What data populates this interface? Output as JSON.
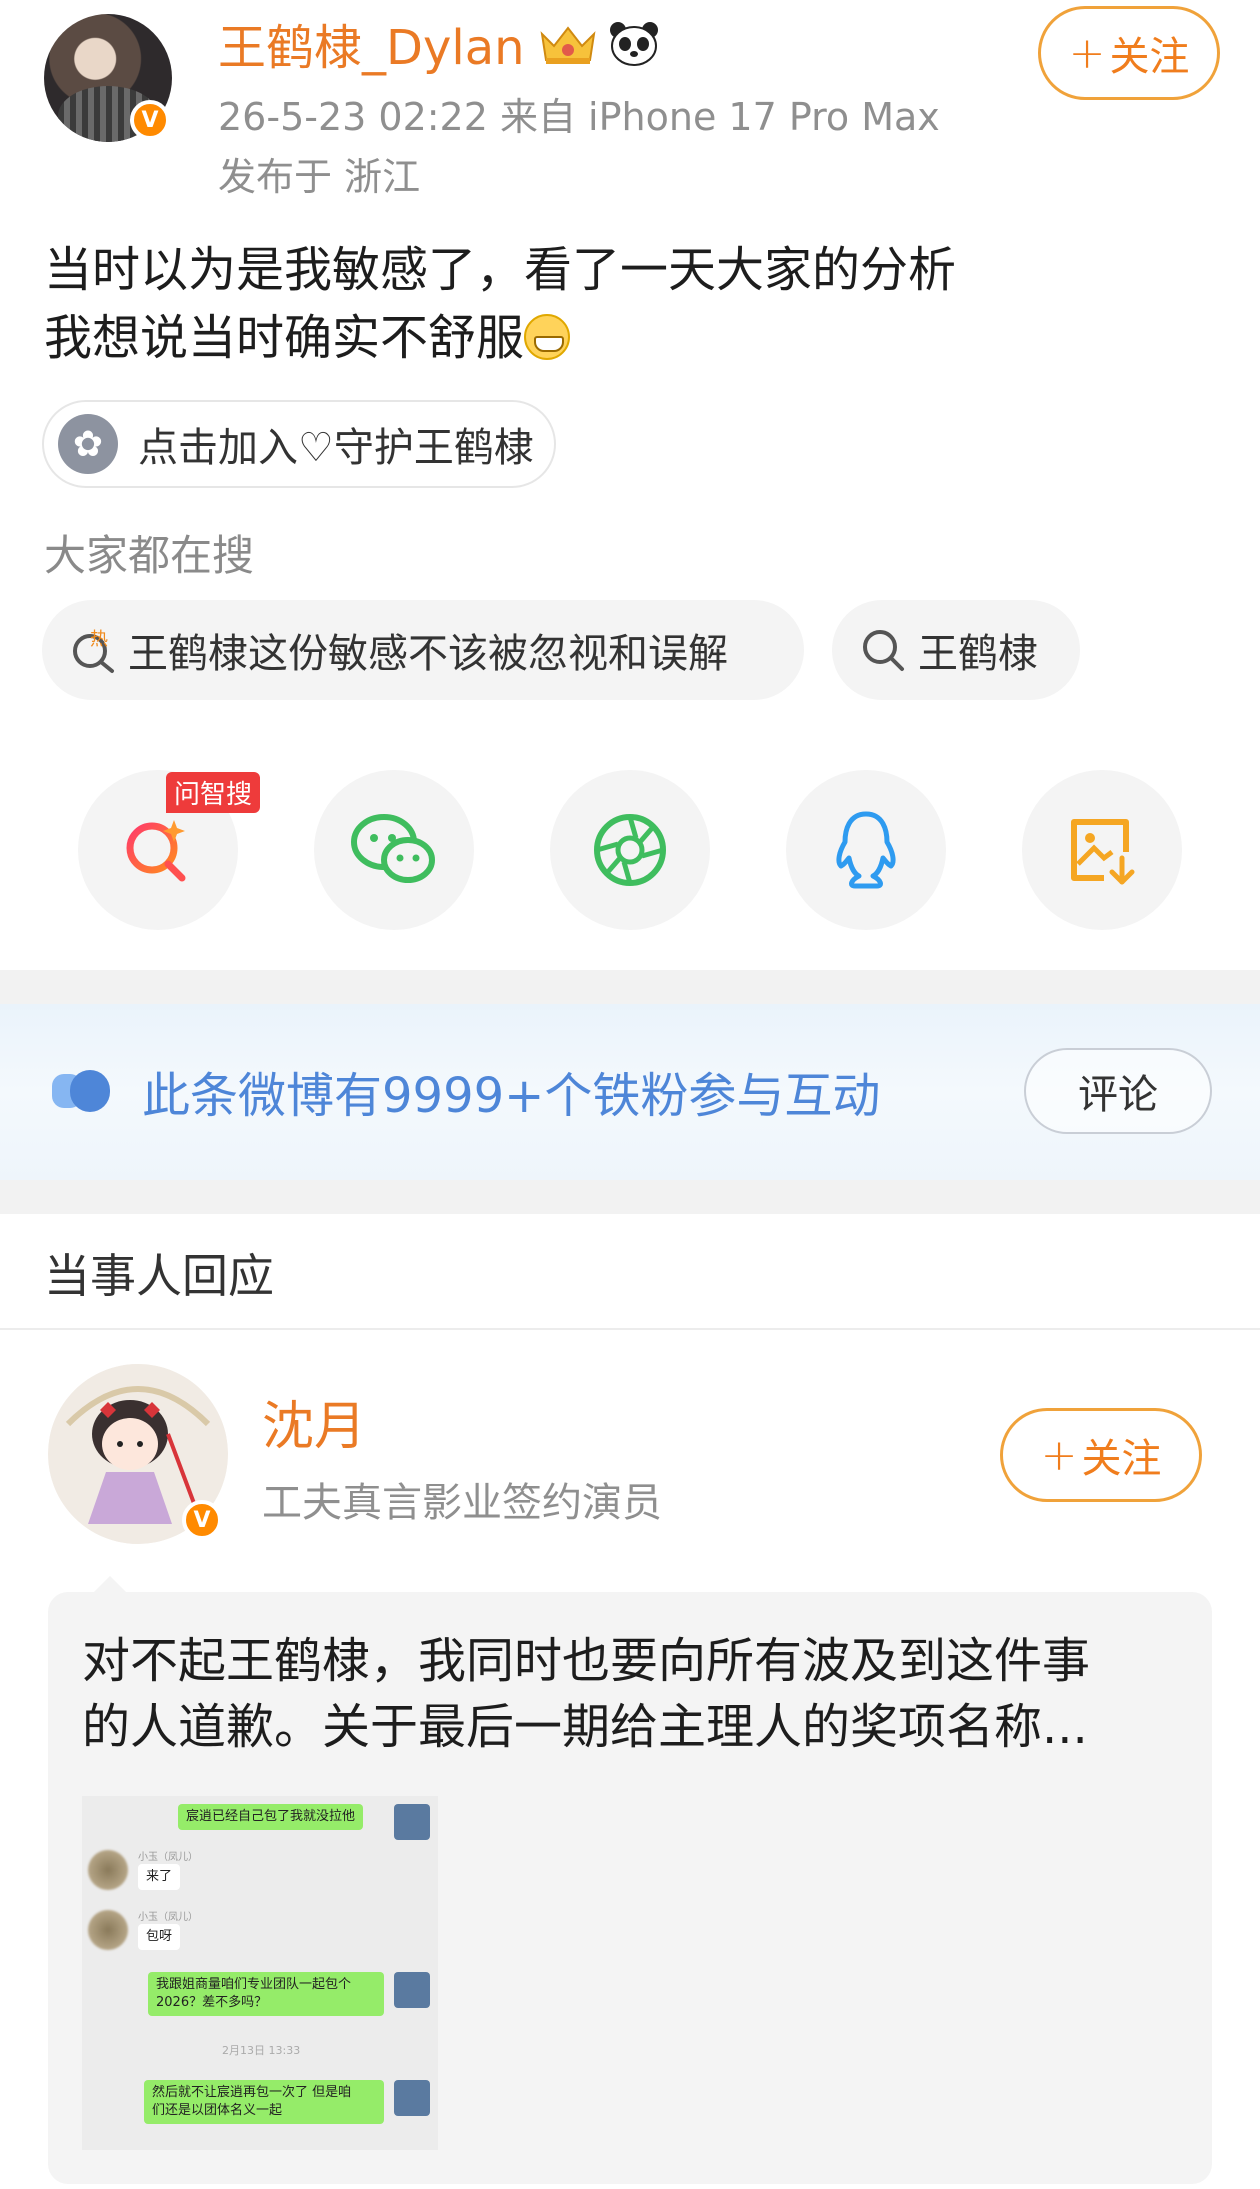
{
  "post": {
    "username": "王鹤棣_Dylan",
    "meta": "26-5-23 02:22  来自 iPhone 17 Pro Max",
    "location": "发布于 浙江",
    "follow_label": "关注",
    "text_line1": "当时以为是我敏感了，看了一天大家的分析",
    "text_line2": "我想说当时确实不舒服",
    "fan_chip": "点击加入♡守护王鹤棣"
  },
  "search": {
    "label": "大家都在搜",
    "tags": [
      "王鹤棣这份敏感不该被忽视和误解",
      "王鹤棣"
    ],
    "hot_marker": "热"
  },
  "share": {
    "ai_badge": "问智搜",
    "icons": [
      "ai-search-icon",
      "wechat-icon",
      "moments-icon",
      "qq-icon",
      "save-image-icon"
    ]
  },
  "banner": {
    "text": "此条微博有9999+个铁粉参与互动",
    "comment_label": "评论"
  },
  "response": {
    "section_title": "当事人回应",
    "name": "沈月",
    "subtitle": "工夫真言影业签约演员",
    "follow_label": "关注",
    "text_line1": "对不起王鹤棣，我同时也要向所有波及到这件事",
    "text_line2": "的人道歉。关于最后一期给主理人的奖项名称...",
    "chat": {
      "msg1": "宸逍已经自己包了我就没拉他",
      "name1": "小玉（凤儿）",
      "msg2": "来了",
      "name2": "小玉（凤儿）",
      "msg3": "包呀",
      "msg4_line1": "我跟姐商量咱们专业团队一起包个",
      "msg4_line2": "2026？差不多吗？",
      "time": "2月13日 13:33",
      "msg5_line1": "然后就不让宸逍再包一次了 但是咱",
      "msg5_line2": "们还是以团体名义一起"
    }
  },
  "colors": {
    "accent_orange": "#ea7a25",
    "banner_blue": "#4e86d8",
    "wechat_green": "#3fbd5e",
    "qq_blue": "#2e9bf0",
    "save_orange": "#f5a623"
  }
}
